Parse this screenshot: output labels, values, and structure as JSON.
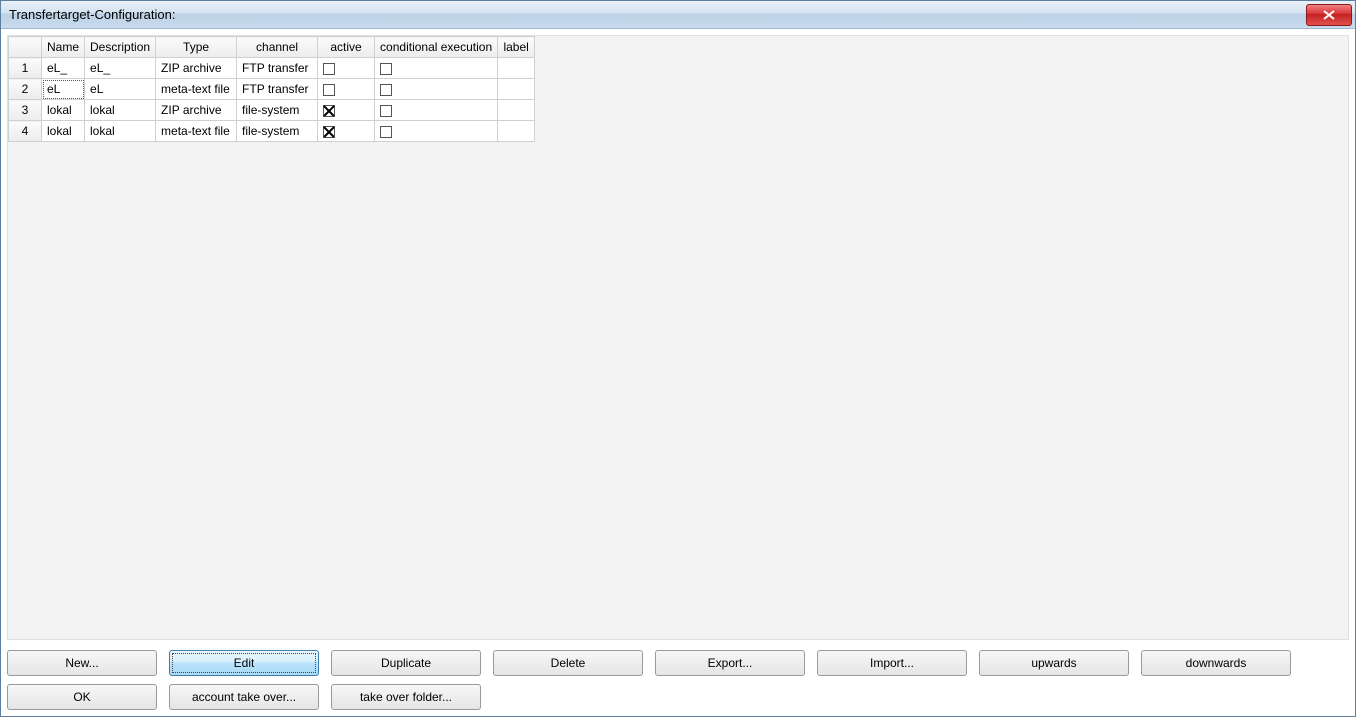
{
  "window": {
    "title": "Transfertarget-Configuration:"
  },
  "columns": {
    "name": "Name",
    "description": "Description",
    "type": "Type",
    "channel": "channel",
    "active": "active",
    "conditional": "conditional execution",
    "label": "label"
  },
  "rows": [
    {
      "num": "1",
      "name": "eL_",
      "description": "eL_",
      "type": "ZIP archive",
      "channel": "FTP transfer",
      "active": false,
      "conditional": false,
      "label": ""
    },
    {
      "num": "2",
      "name": "eL",
      "description": "eL",
      "type": "meta-text file",
      "channel": "FTP transfer",
      "active": false,
      "conditional": false,
      "label": "",
      "selected": true
    },
    {
      "num": "3",
      "name": "lokal",
      "description": "lokal",
      "type": "ZIP archive",
      "channel": "file-system",
      "active": true,
      "conditional": false,
      "label": ""
    },
    {
      "num": "4",
      "name": "lokal",
      "description": "lokal",
      "type": "meta-text file",
      "channel": "file-system",
      "active": true,
      "conditional": false,
      "label": ""
    }
  ],
  "buttons": {
    "row1": [
      {
        "id": "new",
        "label": "New..."
      },
      {
        "id": "edit",
        "label": "Edit",
        "focused": true
      },
      {
        "id": "duplicate",
        "label": "Duplicate"
      },
      {
        "id": "delete",
        "label": "Delete"
      },
      {
        "id": "export",
        "label": "Export..."
      },
      {
        "id": "import",
        "label": "Import..."
      },
      {
        "id": "upwards",
        "label": "upwards"
      },
      {
        "id": "downwards",
        "label": "downwards"
      }
    ],
    "row2": [
      {
        "id": "ok",
        "label": "OK"
      },
      {
        "id": "account-takeover",
        "label": "account take over..."
      },
      {
        "id": "takeover-folder",
        "label": "take over folder..."
      }
    ]
  }
}
